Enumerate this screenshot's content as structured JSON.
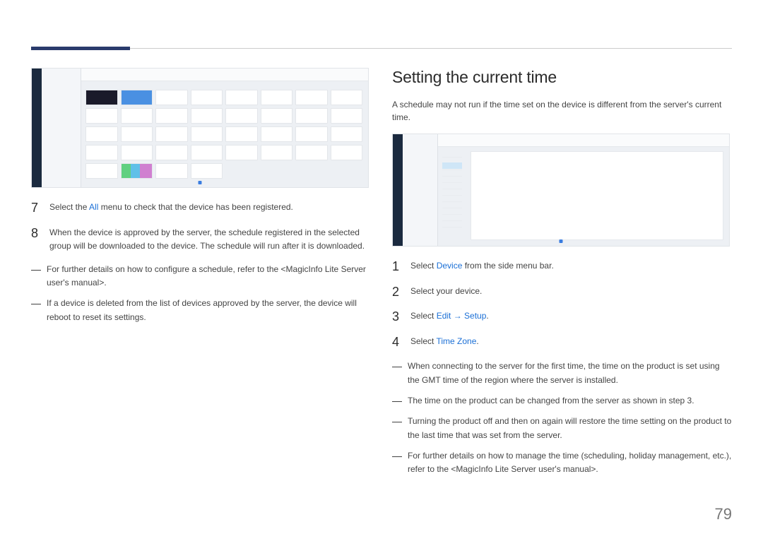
{
  "page_number": "79",
  "left": {
    "step7_num": "7",
    "step7_a": "Select the ",
    "step7_link": "All",
    "step7_b": " menu to check that the device has been registered.",
    "step8_num": "8",
    "step8": "When the device is approved by the server, the schedule registered in the selected group will be downloaded to the device. The schedule will run after it is downloaded.",
    "note1": "For further details on how to configure a schedule, refer to the <MagicInfo Lite Server user's manual>.",
    "note2": "If a device is deleted from the list of devices approved by the server, the device will reboot to reset its settings."
  },
  "right": {
    "heading": "Setting the current time",
    "intro": "A schedule may not run if the time set on the device is different from the server's current time.",
    "step1_num": "1",
    "step1_a": "Select ",
    "step1_link": "Device",
    "step1_b": " from the side menu bar.",
    "step2_num": "2",
    "step2": "Select your device.",
    "step3_num": "3",
    "step3_a": "Select ",
    "step3_link1": "Edit",
    "step3_arrow": " → ",
    "step3_link2": "Setup",
    "step3_b": ".",
    "step4_num": "4",
    "step4_a": "Select ",
    "step4_link": "Time Zone",
    "step4_b": ".",
    "note1": "When connecting to the server for the first time, the time on the product is set using the GMT time of the region where the server is installed.",
    "note2": "The time on the product can be changed from the server as shown in step 3.",
    "note3": "Turning the product off and then on again will restore the time setting on the product to the last time that was set from the server.",
    "note4": "For further details on how to manage the time (scheduling, holiday management, etc.), refer to the <MagicInfo Lite Server user's manual>."
  }
}
